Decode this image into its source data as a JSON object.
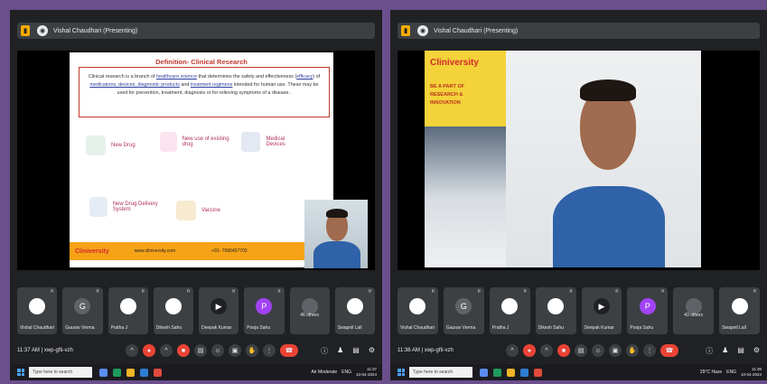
{
  "left": {
    "presenter_label": "Vishal Chaudhari (Presenting)",
    "slide": {
      "title": "Definition- Clinical Research",
      "definition_parts": [
        "Clinical research is a branch of ",
        "healthcare science",
        " that determines the safety and effectiveness (",
        "efficacy",
        ") of ",
        "medications, devices, diagnostic products",
        " and ",
        "treatment regimens",
        " intended for human use. These may be used for prevention, treatment, diagnosis or for relieving symptoms of a disease.."
      ],
      "items": [
        "New Drug",
        "New use of existing drug",
        "Medical Devices",
        "New Drug Delivery System",
        "Vaccine"
      ],
      "footer_logo": "Cliniversity",
      "footer_url": "www.cliniversity.com",
      "footer_phone": "+91- 7066457703"
    },
    "participants": [
      {
        "name": "Vishal Chaudhari",
        "initial": "",
        "color": "#ffffff"
      },
      {
        "name": "Gaurav Verma",
        "initial": "G",
        "color": "#5f6368"
      },
      {
        "name": "Pratha J",
        "initial": "",
        "color": "#ffffff"
      },
      {
        "name": "Dikesh Sahu",
        "initial": "",
        "color": "#ffffff"
      },
      {
        "name": "Deepak Kumar",
        "initial": "",
        "color": "#202124"
      },
      {
        "name": "Pooja Sahu",
        "initial": "P",
        "color": "#a142f4"
      },
      {
        "name": "46 others",
        "initial": "",
        "color": "#3c4043"
      },
      {
        "name": "Swapnil Lall",
        "initial": "",
        "color": "#ffffff"
      }
    ],
    "time": "11:37 AM",
    "meeting_code": "xwp-gfti-vzh",
    "weather": "Air Moderate",
    "clock_time": "11:37",
    "clock_date": "10-04-2024",
    "lang": "ENG"
  },
  "right": {
    "presenter_label": "Vishal Chaudhari (Presenting)",
    "poster_logo": "Cliniversity",
    "poster_lines": [
      "BE A PART OF",
      "RESEARCH &",
      "INNOVATION"
    ],
    "participants": [
      {
        "name": "Vishal Chaudhari",
        "initial": "",
        "color": "#ffffff"
      },
      {
        "name": "Gaurav Verma",
        "initial": "G",
        "color": "#5f6368"
      },
      {
        "name": "Pratha J",
        "initial": "",
        "color": "#ffffff"
      },
      {
        "name": "Dikesh Sahu",
        "initial": "",
        "color": "#ffffff"
      },
      {
        "name": "Deepak Kumar",
        "initial": "",
        "color": "#202124"
      },
      {
        "name": "Pooja Sahu",
        "initial": "P",
        "color": "#a142f4"
      },
      {
        "name": "43 others",
        "initial": "",
        "color": "#3c4043"
      },
      {
        "name": "Swapnil Lall",
        "initial": "",
        "color": "#ffffff"
      }
    ],
    "time": "11:36 AM",
    "meeting_code": "xwp-gfti-vzh",
    "weather": "29°C Haze",
    "clock_time": "11:36",
    "clock_date": "10-04-2024",
    "lang": "ENG"
  },
  "taskbar": {
    "search_placeholder": "Type here to search"
  }
}
